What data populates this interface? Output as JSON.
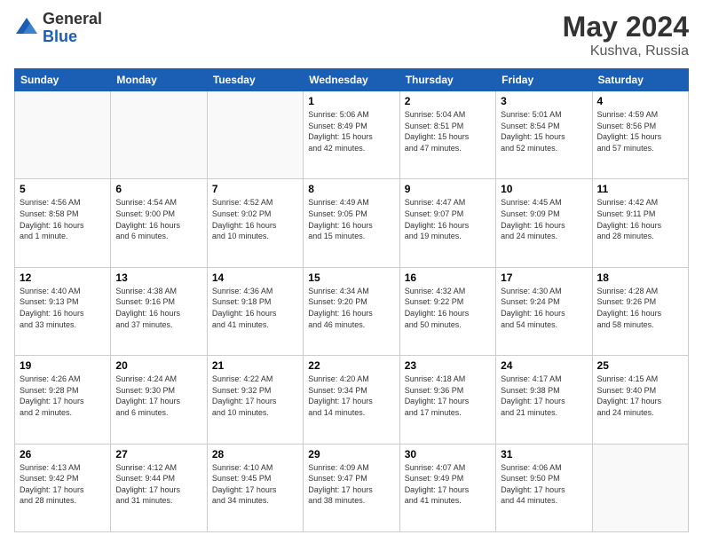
{
  "header": {
    "logo_general": "General",
    "logo_blue": "Blue",
    "month_year": "May 2024",
    "location": "Kushva, Russia"
  },
  "days_of_week": [
    "Sunday",
    "Monday",
    "Tuesday",
    "Wednesday",
    "Thursday",
    "Friday",
    "Saturday"
  ],
  "weeks": [
    [
      {
        "day": "",
        "info": ""
      },
      {
        "day": "",
        "info": ""
      },
      {
        "day": "",
        "info": ""
      },
      {
        "day": "1",
        "info": "Sunrise: 5:06 AM\nSunset: 8:49 PM\nDaylight: 15 hours\nand 42 minutes."
      },
      {
        "day": "2",
        "info": "Sunrise: 5:04 AM\nSunset: 8:51 PM\nDaylight: 15 hours\nand 47 minutes."
      },
      {
        "day": "3",
        "info": "Sunrise: 5:01 AM\nSunset: 8:54 PM\nDaylight: 15 hours\nand 52 minutes."
      },
      {
        "day": "4",
        "info": "Sunrise: 4:59 AM\nSunset: 8:56 PM\nDaylight: 15 hours\nand 57 minutes."
      }
    ],
    [
      {
        "day": "5",
        "info": "Sunrise: 4:56 AM\nSunset: 8:58 PM\nDaylight: 16 hours\nand 1 minute."
      },
      {
        "day": "6",
        "info": "Sunrise: 4:54 AM\nSunset: 9:00 PM\nDaylight: 16 hours\nand 6 minutes."
      },
      {
        "day": "7",
        "info": "Sunrise: 4:52 AM\nSunset: 9:02 PM\nDaylight: 16 hours\nand 10 minutes."
      },
      {
        "day": "8",
        "info": "Sunrise: 4:49 AM\nSunset: 9:05 PM\nDaylight: 16 hours\nand 15 minutes."
      },
      {
        "day": "9",
        "info": "Sunrise: 4:47 AM\nSunset: 9:07 PM\nDaylight: 16 hours\nand 19 minutes."
      },
      {
        "day": "10",
        "info": "Sunrise: 4:45 AM\nSunset: 9:09 PM\nDaylight: 16 hours\nand 24 minutes."
      },
      {
        "day": "11",
        "info": "Sunrise: 4:42 AM\nSunset: 9:11 PM\nDaylight: 16 hours\nand 28 minutes."
      }
    ],
    [
      {
        "day": "12",
        "info": "Sunrise: 4:40 AM\nSunset: 9:13 PM\nDaylight: 16 hours\nand 33 minutes."
      },
      {
        "day": "13",
        "info": "Sunrise: 4:38 AM\nSunset: 9:16 PM\nDaylight: 16 hours\nand 37 minutes."
      },
      {
        "day": "14",
        "info": "Sunrise: 4:36 AM\nSunset: 9:18 PM\nDaylight: 16 hours\nand 41 minutes."
      },
      {
        "day": "15",
        "info": "Sunrise: 4:34 AM\nSunset: 9:20 PM\nDaylight: 16 hours\nand 46 minutes."
      },
      {
        "day": "16",
        "info": "Sunrise: 4:32 AM\nSunset: 9:22 PM\nDaylight: 16 hours\nand 50 minutes."
      },
      {
        "day": "17",
        "info": "Sunrise: 4:30 AM\nSunset: 9:24 PM\nDaylight: 16 hours\nand 54 minutes."
      },
      {
        "day": "18",
        "info": "Sunrise: 4:28 AM\nSunset: 9:26 PM\nDaylight: 16 hours\nand 58 minutes."
      }
    ],
    [
      {
        "day": "19",
        "info": "Sunrise: 4:26 AM\nSunset: 9:28 PM\nDaylight: 17 hours\nand 2 minutes."
      },
      {
        "day": "20",
        "info": "Sunrise: 4:24 AM\nSunset: 9:30 PM\nDaylight: 17 hours\nand 6 minutes."
      },
      {
        "day": "21",
        "info": "Sunrise: 4:22 AM\nSunset: 9:32 PM\nDaylight: 17 hours\nand 10 minutes."
      },
      {
        "day": "22",
        "info": "Sunrise: 4:20 AM\nSunset: 9:34 PM\nDaylight: 17 hours\nand 14 minutes."
      },
      {
        "day": "23",
        "info": "Sunrise: 4:18 AM\nSunset: 9:36 PM\nDaylight: 17 hours\nand 17 minutes."
      },
      {
        "day": "24",
        "info": "Sunrise: 4:17 AM\nSunset: 9:38 PM\nDaylight: 17 hours\nand 21 minutes."
      },
      {
        "day": "25",
        "info": "Sunrise: 4:15 AM\nSunset: 9:40 PM\nDaylight: 17 hours\nand 24 minutes."
      }
    ],
    [
      {
        "day": "26",
        "info": "Sunrise: 4:13 AM\nSunset: 9:42 PM\nDaylight: 17 hours\nand 28 minutes."
      },
      {
        "day": "27",
        "info": "Sunrise: 4:12 AM\nSunset: 9:44 PM\nDaylight: 17 hours\nand 31 minutes."
      },
      {
        "day": "28",
        "info": "Sunrise: 4:10 AM\nSunset: 9:45 PM\nDaylight: 17 hours\nand 34 minutes."
      },
      {
        "day": "29",
        "info": "Sunrise: 4:09 AM\nSunset: 9:47 PM\nDaylight: 17 hours\nand 38 minutes."
      },
      {
        "day": "30",
        "info": "Sunrise: 4:07 AM\nSunset: 9:49 PM\nDaylight: 17 hours\nand 41 minutes."
      },
      {
        "day": "31",
        "info": "Sunrise: 4:06 AM\nSunset: 9:50 PM\nDaylight: 17 hours\nand 44 minutes."
      },
      {
        "day": "",
        "info": ""
      }
    ]
  ]
}
